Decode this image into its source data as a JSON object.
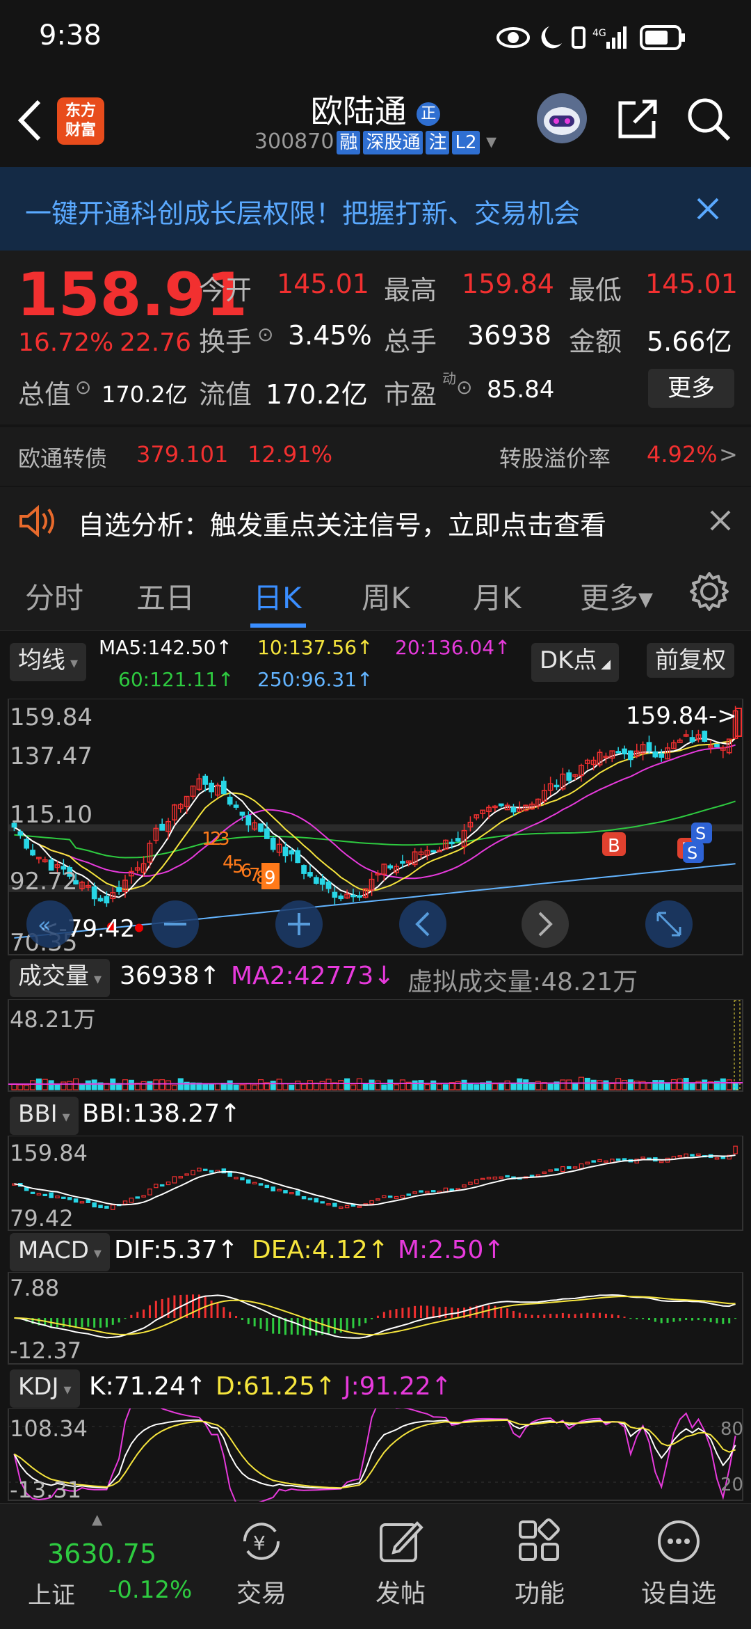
{
  "status_bar": {
    "time": "9:38"
  },
  "header": {
    "brand_logo": "东方\n财富",
    "title": "欧陆通",
    "title_badge": "正",
    "code": "300870",
    "tags": [
      "融",
      "深股通",
      "注",
      "L2"
    ]
  },
  "banner": {
    "text": "一键开通科创成长层权限！把握打新、交易机会"
  },
  "quote": {
    "price": "158.91",
    "change_pct": "16.72%",
    "change_amt": "22.76",
    "open_label": "今开",
    "open": "145.01",
    "high_label": "最高",
    "high": "159.84",
    "low_label": "最低",
    "low": "145.01",
    "turnover_label": "换手",
    "turnover": "3.45%",
    "volume_label": "总手",
    "volume": "36938",
    "amount_label": "金额",
    "amount": "5.66亿",
    "mktcap_label": "总值",
    "mktcap": "170.2亿",
    "float_label": "流值",
    "float": "170.2亿",
    "pe_label": "市盈",
    "pe_sup": "动",
    "pe": "85.84",
    "more_label": "更多"
  },
  "bond": {
    "label": "欧通转债",
    "price": "379.101",
    "pct": "12.91%",
    "premium_label": "转股溢价率",
    "premium": "4.92%",
    "arrow": ">"
  },
  "notice": {
    "text": "自选分析：触发重点关注信号，立即点击查看"
  },
  "tabs": [
    "分时",
    "五日",
    "日K",
    "周K",
    "月K",
    "更多▾"
  ],
  "active_tab": 2,
  "kline": {
    "ma_button": "均线",
    "ma5": "MA5:142.50↑",
    "ma10": "10:137.56↑",
    "ma20": "20:136.04↑",
    "ma60": "60:121.11↑",
    "ma250": "250:96.31↑",
    "dk_button": "DK点",
    "fq_button": "前复权",
    "y_labels": [
      "159.84",
      "137.47",
      "115.10",
      "92.72",
      "70.35"
    ],
    "high_marker": "159.84->",
    "low_marker": "<-79.42",
    "signals": [
      "B",
      "B",
      "S",
      "S"
    ],
    "nine_marks": [
      "1",
      "2",
      "3",
      "4",
      "5",
      "6",
      "7",
      "8",
      "9"
    ]
  },
  "volume": {
    "button": "成交量",
    "vol": "36938↑",
    "ma2": "MA2:42773↓",
    "virtual": "虚拟成交量:48.21万",
    "y_top": "48.21万"
  },
  "bbi": {
    "button": "BBI",
    "value": "BBI:138.27↑",
    "y_top": "159.84",
    "y_bottom": "79.42"
  },
  "macd": {
    "button": "MACD",
    "dif": "DIF:5.37↑",
    "dea": "DEA:4.12↑",
    "m": "M:2.50↑",
    "y_top": "7.88",
    "y_bottom": "-12.37"
  },
  "kdj": {
    "button": "KDJ",
    "k": "K:71.24↑",
    "d": "D:61.25↑",
    "j": "J:91.22↑",
    "y_top": "108.34",
    "y_bottom": "-13.31",
    "r80": "80",
    "r20": "20"
  },
  "bottom_nav": {
    "index_value": "3630.75",
    "index_name": "上证",
    "index_pct": "-0.12%",
    "items": [
      "交易",
      "发帖",
      "功能",
      "设自选"
    ]
  },
  "colors": {
    "up": "#f23030",
    "down": "#2ecb40",
    "accent": "#3a8eff",
    "ma5": "#ffffff",
    "ma10": "#f6e53d",
    "ma20": "#e73adc",
    "ma60": "#2ecb40",
    "ma250": "#63b4ff"
  }
}
